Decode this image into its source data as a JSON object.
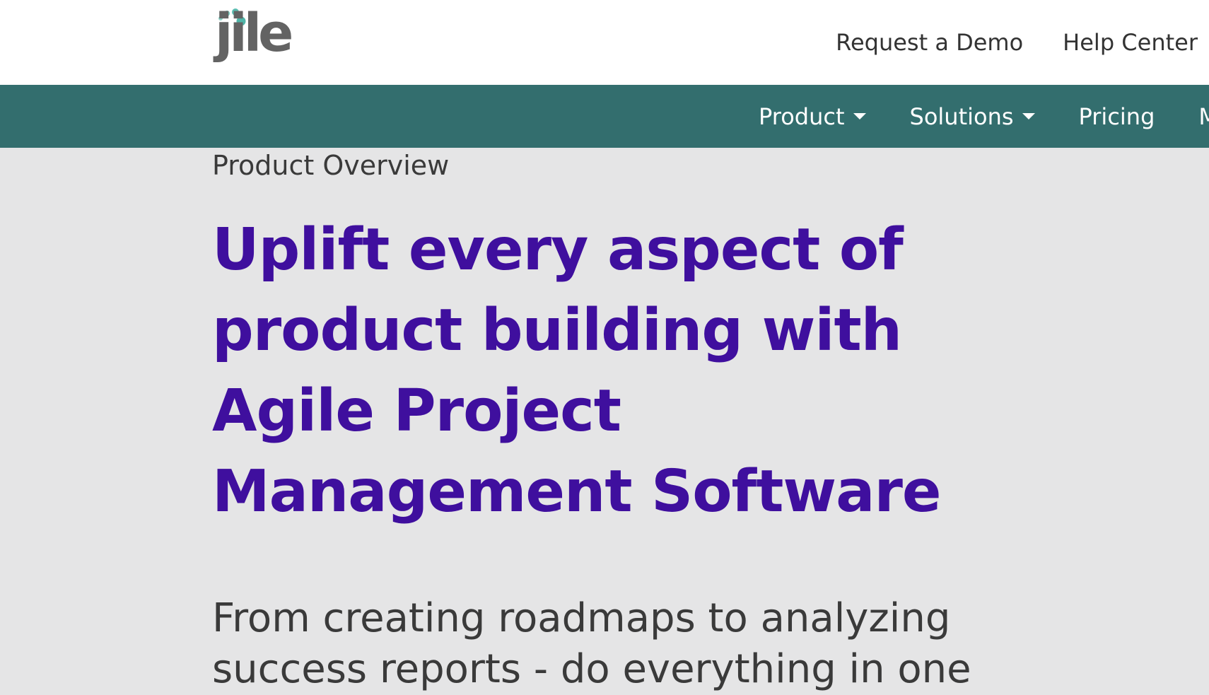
{
  "header": {
    "logo_text": "jile",
    "links": {
      "request_demo": "Request a Demo",
      "help_center": "Help Center"
    }
  },
  "nav": {
    "product": "Product",
    "solutions": "Solutions",
    "pricing": "Pricing",
    "more_partial": "M"
  },
  "hero": {
    "eyebrow": "Product Overview",
    "headline_line1": "Uplift every aspect of",
    "headline_line2": "product building with",
    "headline_line3": "Agile Project",
    "headline_line4": "Management Software",
    "subtext_line1": "From creating roadmaps to analyzing",
    "subtext_line2": "success reports - do everything in one"
  },
  "colors": {
    "nav_background": "#336e6e",
    "page_background": "#e5e5e6",
    "headline": "#3f0f9e",
    "logo_dots": "#5bbdb0",
    "logo_text": "#636363"
  }
}
